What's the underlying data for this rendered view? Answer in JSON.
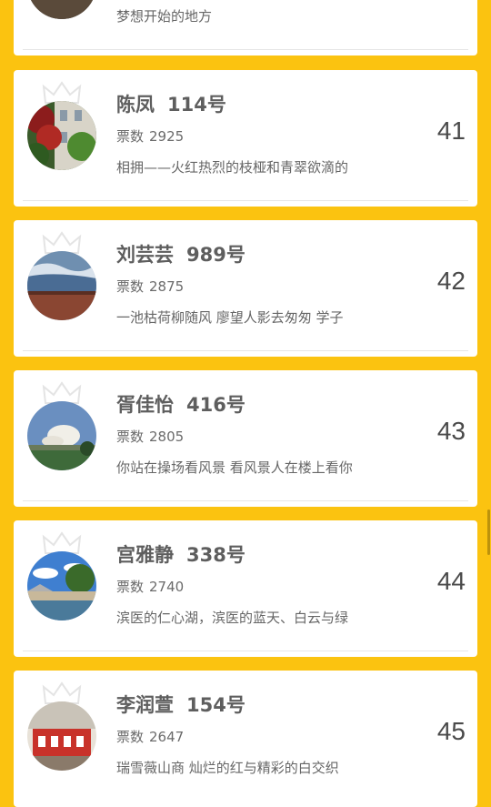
{
  "first_card": {
    "desc": "梦想开始的地方"
  },
  "cards": [
    {
      "name": "陈凤",
      "number": "114号",
      "votes_label": "票数",
      "votes": "2925",
      "desc": "相拥——火红热烈的枝桠和青翠欲滴的",
      "rank": "41"
    },
    {
      "name": "刘芸芸",
      "number": "989号",
      "votes_label": "票数",
      "votes": "2875",
      "desc": "一池枯荷柳随风 廖望人影去匆匆 学子",
      "rank": "42"
    },
    {
      "name": "胥佳怡",
      "number": "416号",
      "votes_label": "票数",
      "votes": "2805",
      "desc": "你站在操场看风景 看风景人在楼上看你",
      "rank": "43"
    },
    {
      "name": "宫雅静",
      "number": "338号",
      "votes_label": "票数",
      "votes": "2740",
      "desc": "滨医的仁心湖，滨医的蓝天、白云与绿",
      "rank": "44"
    },
    {
      "name": "李润萱",
      "number": "154号",
      "votes_label": "票数",
      "votes": "2647",
      "desc": "瑞雪薇山商 灿烂的红与精彩的白交织",
      "rank": "45"
    }
  ],
  "icons": {
    "crown": "crown-icon",
    "avatar": "avatar-photo"
  },
  "colors": {
    "background": "#fbc310",
    "card": "#ffffff",
    "text_primary": "#5e5e5e"
  }
}
